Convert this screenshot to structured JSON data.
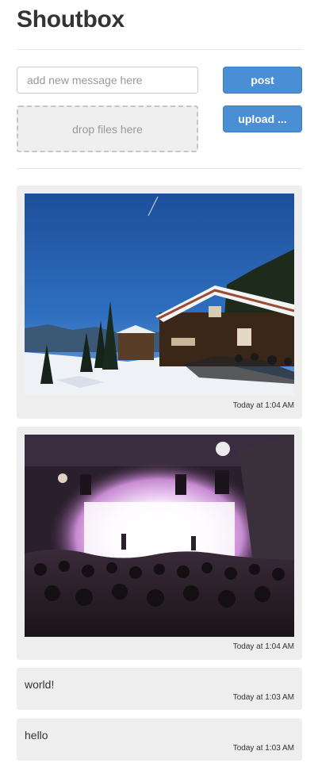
{
  "header": {
    "title": "Shoutbox"
  },
  "composer": {
    "placeholder": "add new message here",
    "dropzone_label": "drop files here",
    "post_label": "post",
    "upload_label": "upload ..."
  },
  "messages": [
    {
      "type": "image",
      "subject": "snowy mountain chalet",
      "time": "Today at 1:04 AM"
    },
    {
      "type": "image",
      "subject": "concert crowd with stage lights",
      "time": "Today at 1:04 AM"
    },
    {
      "type": "text",
      "text": "world!",
      "time": "Today at 1:03 AM"
    },
    {
      "type": "text",
      "text": "hello",
      "time": "Today at 1:03 AM"
    }
  ],
  "colors": {
    "button": "#4a8fd6",
    "card_bg": "#eeeeee",
    "dropzone_bg": "#efefef",
    "divider": "#e5e5e5"
  }
}
